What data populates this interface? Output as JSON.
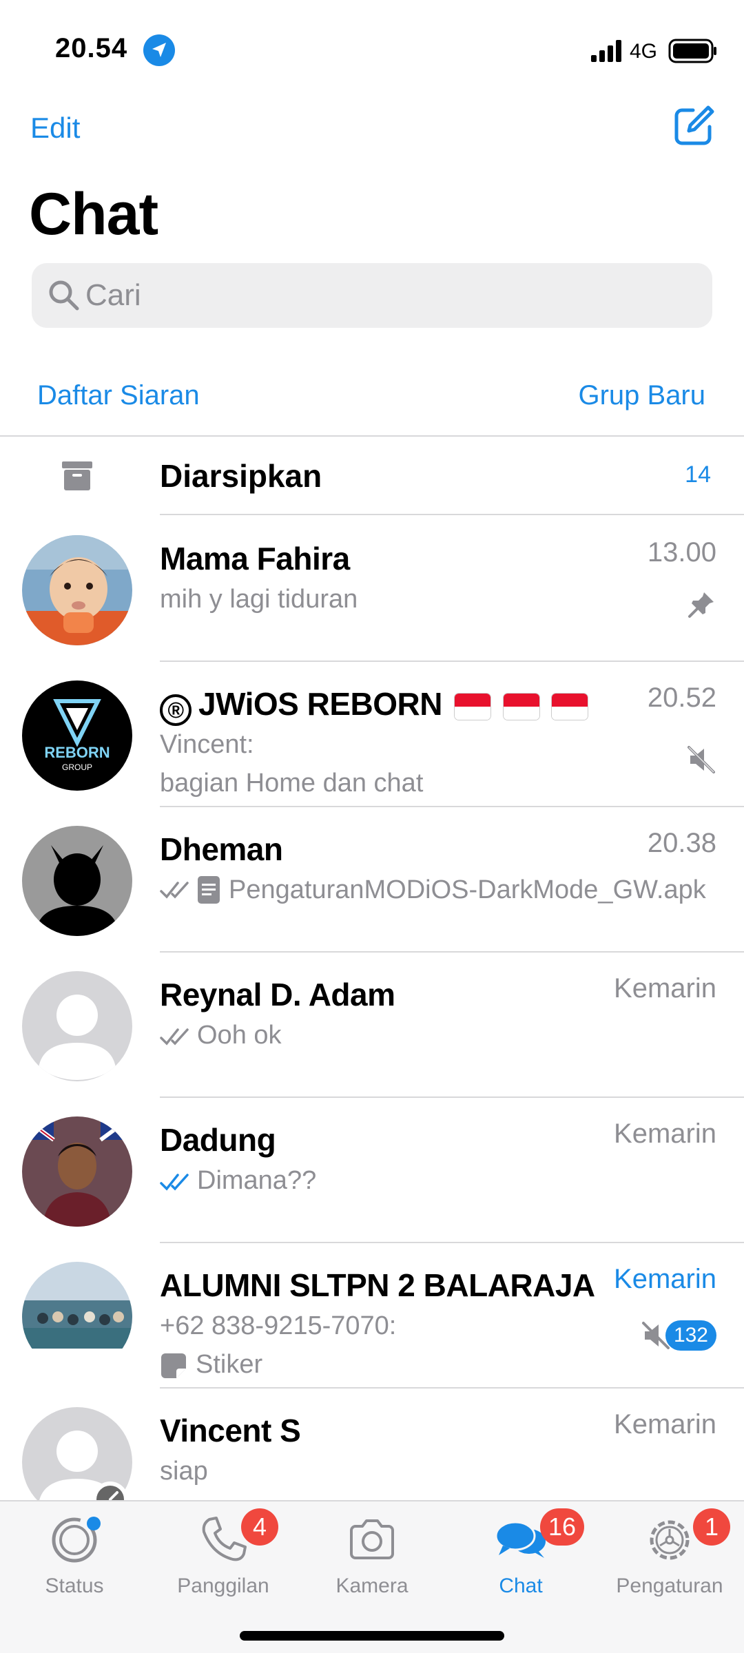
{
  "status_bar": {
    "time": "20.54",
    "network": "4G"
  },
  "header": {
    "edit_label": "Edit",
    "title": "Chat"
  },
  "search": {
    "placeholder": "Cari"
  },
  "links": {
    "broadcast": "Daftar Siaran",
    "new_group": "Grup Baru"
  },
  "archived": {
    "label": "Diarsipkan",
    "count": "14"
  },
  "chats": [
    {
      "name": "Mama Fahira",
      "time": "13.00",
      "message": "mih y lagi tiduran",
      "pinned": true
    },
    {
      "name": "JWiOS REBORN",
      "name_prefix": "®",
      "time": "20.52",
      "sender": "Vincent:",
      "message": "bagian Home dan chat",
      "muted": true
    },
    {
      "name": "Dheman",
      "time": "20.38",
      "message": "PengaturanMODiOS-DarkMode_GW.apk",
      "ticks": "read-grey",
      "attachment": "document-icon"
    },
    {
      "name": "Reynal D. Adam",
      "time": "Kemarin",
      "message": "Ooh ok",
      "ticks": "read-grey"
    },
    {
      "name": "Dadung",
      "time": "Kemarin",
      "message": "Dimana??",
      "ticks": "read-blue"
    },
    {
      "name": "ALUMNI SLTPN  2  BALARAJA",
      "time": "Kemarin",
      "sender": "+62 838-9215-7070:",
      "message": "Stiker",
      "muted": true,
      "unread": "132"
    },
    {
      "name": "Vincent S",
      "time": "Kemarin",
      "message": "siap"
    }
  ],
  "tabs": [
    {
      "label": "Status",
      "icon": "status-icon"
    },
    {
      "label": "Panggilan",
      "icon": "phone-icon",
      "badge": "4"
    },
    {
      "label": "Kamera",
      "icon": "camera-icon"
    },
    {
      "label": "Chat",
      "icon": "chat-bubbles-icon",
      "badge": "16",
      "active": true
    },
    {
      "label": "Pengaturan",
      "icon": "gear-icon",
      "badge": "1"
    }
  ],
  "colors": {
    "accent": "#1a8ae6",
    "badge_red": "#f0483e",
    "secondary_text": "#8e8e93"
  }
}
